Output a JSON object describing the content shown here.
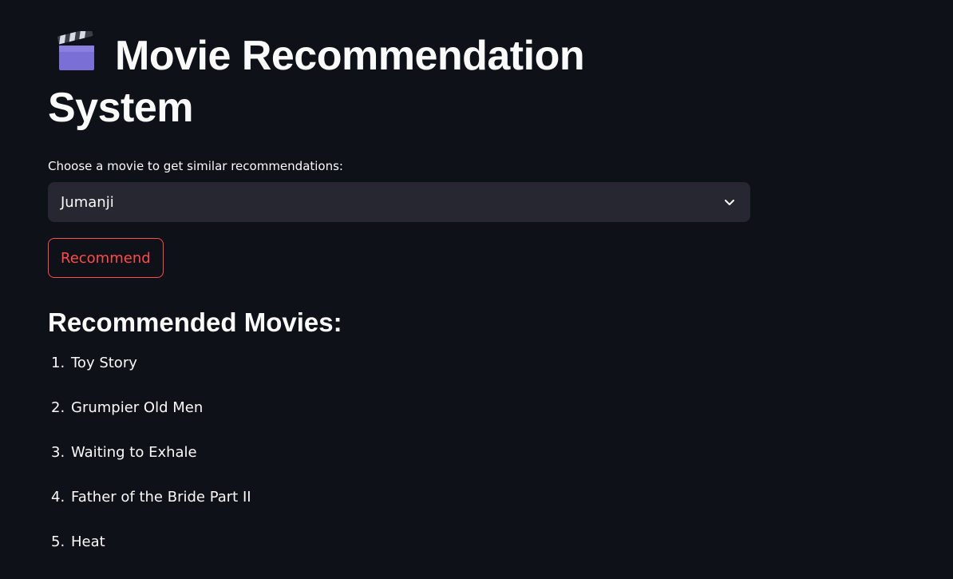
{
  "title": {
    "icon": "clapper-board-icon",
    "text": "Movie Recommendation System"
  },
  "movie_select": {
    "label": "Choose a movie to get similar recommendations:",
    "selected_value": "Jumanji",
    "chevron_icon": "chevron-down-icon"
  },
  "recommend_button": {
    "label": "Recommend",
    "color": "#ff4b4b"
  },
  "results": {
    "heading": "Recommended Movies:",
    "items": [
      {
        "number": "1.",
        "title": "Toy Story"
      },
      {
        "number": "2.",
        "title": "Grumpier Old Men"
      },
      {
        "number": "3.",
        "title": "Waiting to Exhale"
      },
      {
        "number": "4.",
        "title": "Father of the Bride Part II"
      },
      {
        "number": "5.",
        "title": "Heat"
      }
    ]
  },
  "theme": {
    "background": "#0e1117",
    "select_background": "#262730",
    "text": "#fafafa",
    "accent": "#ff4b4b"
  }
}
